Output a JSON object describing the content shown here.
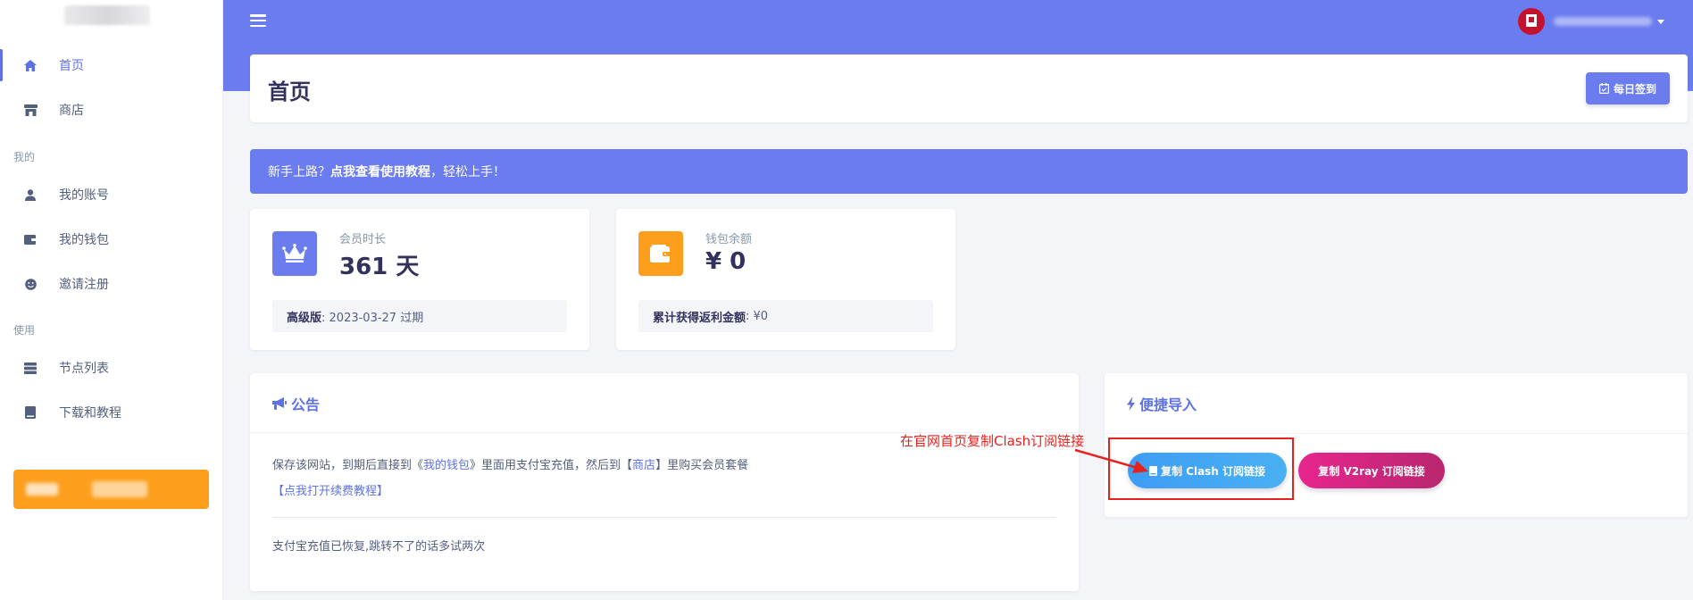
{
  "sidebar": {
    "items": [
      {
        "label": "首页",
        "icon": "home-icon"
      },
      {
        "label": "商店",
        "icon": "shop-icon"
      },
      {
        "label": "我的账号",
        "icon": "user-icon"
      },
      {
        "label": "我的钱包",
        "icon": "wallet-icon"
      },
      {
        "label": "邀请注册",
        "icon": "smile-icon"
      },
      {
        "label": "节点列表",
        "icon": "server-icon"
      },
      {
        "label": "下载和教程",
        "icon": "book-icon"
      }
    ],
    "headings": [
      "我的",
      "使用"
    ]
  },
  "header": {
    "title": "首页",
    "checkin_label": "每日签到"
  },
  "alert": {
    "prefix": "新手上路？",
    "link": "点我查看使用教程",
    "suffix": "，轻松上手！"
  },
  "stats": {
    "membership": {
      "label": "会员时长",
      "value": "361 天",
      "footer_bold": "高级版",
      "footer_rest": ": 2023-03-27 过期"
    },
    "wallet": {
      "label": "钱包余额",
      "value": "¥ 0",
      "footer_bold": "累计获得返利金额",
      "footer_rest": ": ¥0"
    }
  },
  "notice": {
    "title": "公告",
    "line1_a": "保存该网站，到期后直接到《",
    "line1_link1": "我的钱包",
    "line1_b": "》里面用支付宝充值，然后到【",
    "line1_link2": "商店",
    "line1_c": "】里购买会员套餐",
    "link": "【点我打开续费教程】",
    "line2": "支付宝充值已恢复,跳转不了的话多试两次"
  },
  "quick_import": {
    "title": "便捷导入",
    "clash_label": "复制 Clash 订阅链接",
    "v2ray_label": "复制 V2ray 订阅链接"
  },
  "annotation": {
    "text": "在官网首页复制Clash订阅链接",
    "color": "#e8211d"
  },
  "colors": {
    "primary": "#6b7cef",
    "accent_orange": "#fd9f1d",
    "clash_blue": "#3d9df5",
    "v2ray_pink": "#e8258e"
  }
}
